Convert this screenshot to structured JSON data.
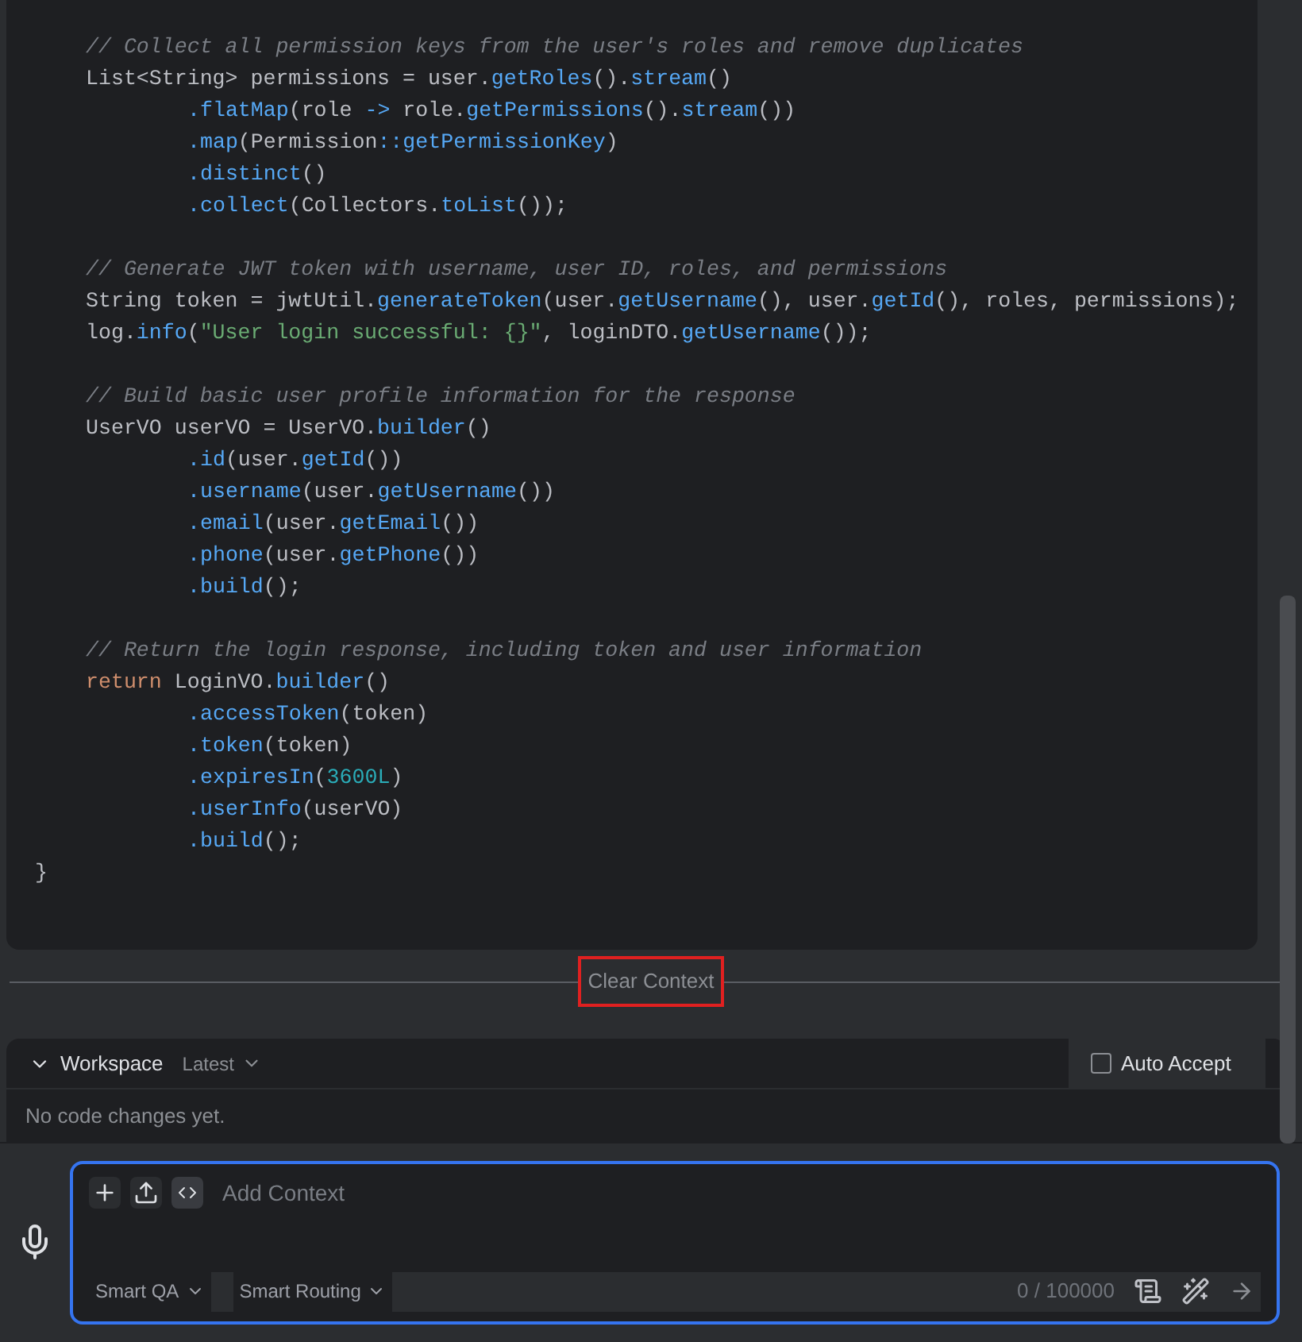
{
  "code_blocks": [
    {
      "lines": [
        {
          "kind": "statement",
          "tokens": [
            {
              "kind": "comment",
              "text": "// Collect all permission keys from the user's roles and remove duplicates"
            }
          ]
        },
        {
          "kind": "statement",
          "tokens": [
            {
              "kind": "plain",
              "text": "List<String> permissions = user."
            },
            {
              "kind": "method",
              "text": "getRoles"
            },
            {
              "kind": "plain",
              "text": "()."
            },
            {
              "kind": "method",
              "text": "stream"
            },
            {
              "kind": "plain",
              "text": "()"
            }
          ]
        },
        {
          "kind": "chain",
          "tokens": [
            {
              "kind": "method",
              "text": ".flatMap"
            },
            {
              "kind": "plain",
              "text": "(role "
            },
            {
              "kind": "method",
              "text": "->"
            },
            {
              "kind": "plain",
              "text": " role."
            },
            {
              "kind": "method",
              "text": "getPermissions"
            },
            {
              "kind": "plain",
              "text": "()."
            },
            {
              "kind": "method",
              "text": "stream"
            },
            {
              "kind": "plain",
              "text": "())"
            }
          ]
        },
        {
          "kind": "chain",
          "tokens": [
            {
              "kind": "method",
              "text": ".map"
            },
            {
              "kind": "plain",
              "text": "(Permission"
            },
            {
              "kind": "method",
              "text": "::getPermissionKey"
            },
            {
              "kind": "plain",
              "text": ")"
            }
          ]
        },
        {
          "kind": "chain",
          "tokens": [
            {
              "kind": "method",
              "text": ".distinct"
            },
            {
              "kind": "plain",
              "text": "()"
            }
          ]
        },
        {
          "kind": "chain",
          "tokens": [
            {
              "kind": "method",
              "text": ".collect"
            },
            {
              "kind": "plain",
              "text": "(Collectors."
            },
            {
              "kind": "method",
              "text": "toList"
            },
            {
              "kind": "plain",
              "text": "());"
            }
          ]
        }
      ]
    },
    {
      "lines": [
        {
          "kind": "statement",
          "tokens": [
            {
              "kind": "comment",
              "text": "// Generate JWT token with username, user ID, roles, and permissions"
            }
          ]
        },
        {
          "kind": "statement",
          "tokens": [
            {
              "kind": "plain",
              "text": "String token = jwtUtil."
            },
            {
              "kind": "method",
              "text": "generateToken"
            },
            {
              "kind": "plain",
              "text": "(user."
            },
            {
              "kind": "method",
              "text": "getUsername"
            },
            {
              "kind": "plain",
              "text": "(), user."
            },
            {
              "kind": "method",
              "text": "getId"
            },
            {
              "kind": "plain",
              "text": "(), roles, permissions);"
            }
          ]
        },
        {
          "kind": "statement",
          "tokens": [
            {
              "kind": "plain",
              "text": "log."
            },
            {
              "kind": "method",
              "text": "info"
            },
            {
              "kind": "plain",
              "text": "("
            },
            {
              "kind": "string",
              "text": "\"User login successful: {}\""
            },
            {
              "kind": "plain",
              "text": ", loginDTO."
            },
            {
              "kind": "method",
              "text": "getUsername"
            },
            {
              "kind": "plain",
              "text": "());"
            }
          ]
        }
      ]
    },
    {
      "lines": [
        {
          "kind": "statement",
          "tokens": [
            {
              "kind": "comment",
              "text": "// Build basic user profile information for the response"
            }
          ]
        },
        {
          "kind": "statement",
          "tokens": [
            {
              "kind": "plain",
              "text": "UserVO userVO = UserVO."
            },
            {
              "kind": "method",
              "text": "builder"
            },
            {
              "kind": "plain",
              "text": "()"
            }
          ]
        },
        {
          "kind": "chain",
          "tokens": [
            {
              "kind": "method",
              "text": ".id"
            },
            {
              "kind": "plain",
              "text": "(user."
            },
            {
              "kind": "method",
              "text": "getId"
            },
            {
              "kind": "plain",
              "text": "())"
            }
          ]
        },
        {
          "kind": "chain",
          "tokens": [
            {
              "kind": "method",
              "text": ".username"
            },
            {
              "kind": "plain",
              "text": "(user."
            },
            {
              "kind": "method",
              "text": "getUsername"
            },
            {
              "kind": "plain",
              "text": "())"
            }
          ]
        },
        {
          "kind": "chain",
          "tokens": [
            {
              "kind": "method",
              "text": ".email"
            },
            {
              "kind": "plain",
              "text": "(user."
            },
            {
              "kind": "method",
              "text": "getEmail"
            },
            {
              "kind": "plain",
              "text": "())"
            }
          ]
        },
        {
          "kind": "chain",
          "tokens": [
            {
              "kind": "method",
              "text": ".phone"
            },
            {
              "kind": "plain",
              "text": "(user."
            },
            {
              "kind": "method",
              "text": "getPhone"
            },
            {
              "kind": "plain",
              "text": "())"
            }
          ]
        },
        {
          "kind": "chain",
          "tokens": [
            {
              "kind": "method",
              "text": ".build"
            },
            {
              "kind": "plain",
              "text": "();"
            }
          ]
        }
      ]
    },
    {
      "lines": [
        {
          "kind": "statement",
          "tokens": [
            {
              "kind": "comment",
              "text": "// Return the login response, including token and user information"
            }
          ]
        },
        {
          "kind": "statement",
          "tokens": [
            {
              "kind": "keyword",
              "text": "return"
            },
            {
              "kind": "plain",
              "text": " LoginVO."
            },
            {
              "kind": "method",
              "text": "builder"
            },
            {
              "kind": "plain",
              "text": "()"
            }
          ]
        },
        {
          "kind": "chain",
          "tokens": [
            {
              "kind": "method",
              "text": ".accessToken"
            },
            {
              "kind": "plain",
              "text": "(token)"
            }
          ]
        },
        {
          "kind": "chain",
          "tokens": [
            {
              "kind": "method",
              "text": ".token"
            },
            {
              "kind": "plain",
              "text": "(token)"
            }
          ]
        },
        {
          "kind": "chain",
          "tokens": [
            {
              "kind": "method",
              "text": ".expiresIn"
            },
            {
              "kind": "plain",
              "text": "("
            },
            {
              "kind": "number",
              "text": "3600L"
            },
            {
              "kind": "plain",
              "text": ")"
            }
          ]
        },
        {
          "kind": "chain",
          "tokens": [
            {
              "kind": "method",
              "text": ".userInfo"
            },
            {
              "kind": "plain",
              "text": "(userVO)"
            }
          ]
        },
        {
          "kind": "chain",
          "tokens": [
            {
              "kind": "method",
              "text": ".build"
            },
            {
              "kind": "plain",
              "text": "();"
            }
          ]
        },
        {
          "kind": "closing",
          "tokens": [
            {
              "kind": "plain",
              "text": "}"
            }
          ]
        }
      ]
    }
  ],
  "clear_context": "Clear Context",
  "workspace": {
    "title": "Workspace",
    "expanded": true,
    "version": "Latest",
    "auto_accept": {
      "label": "Auto Accept",
      "checked": false
    },
    "message": "No code changes yet."
  },
  "input": {
    "placeholder": "Add Context",
    "mode": "Smart QA",
    "routing": "Smart Routing",
    "counter": "0 / 100000"
  }
}
